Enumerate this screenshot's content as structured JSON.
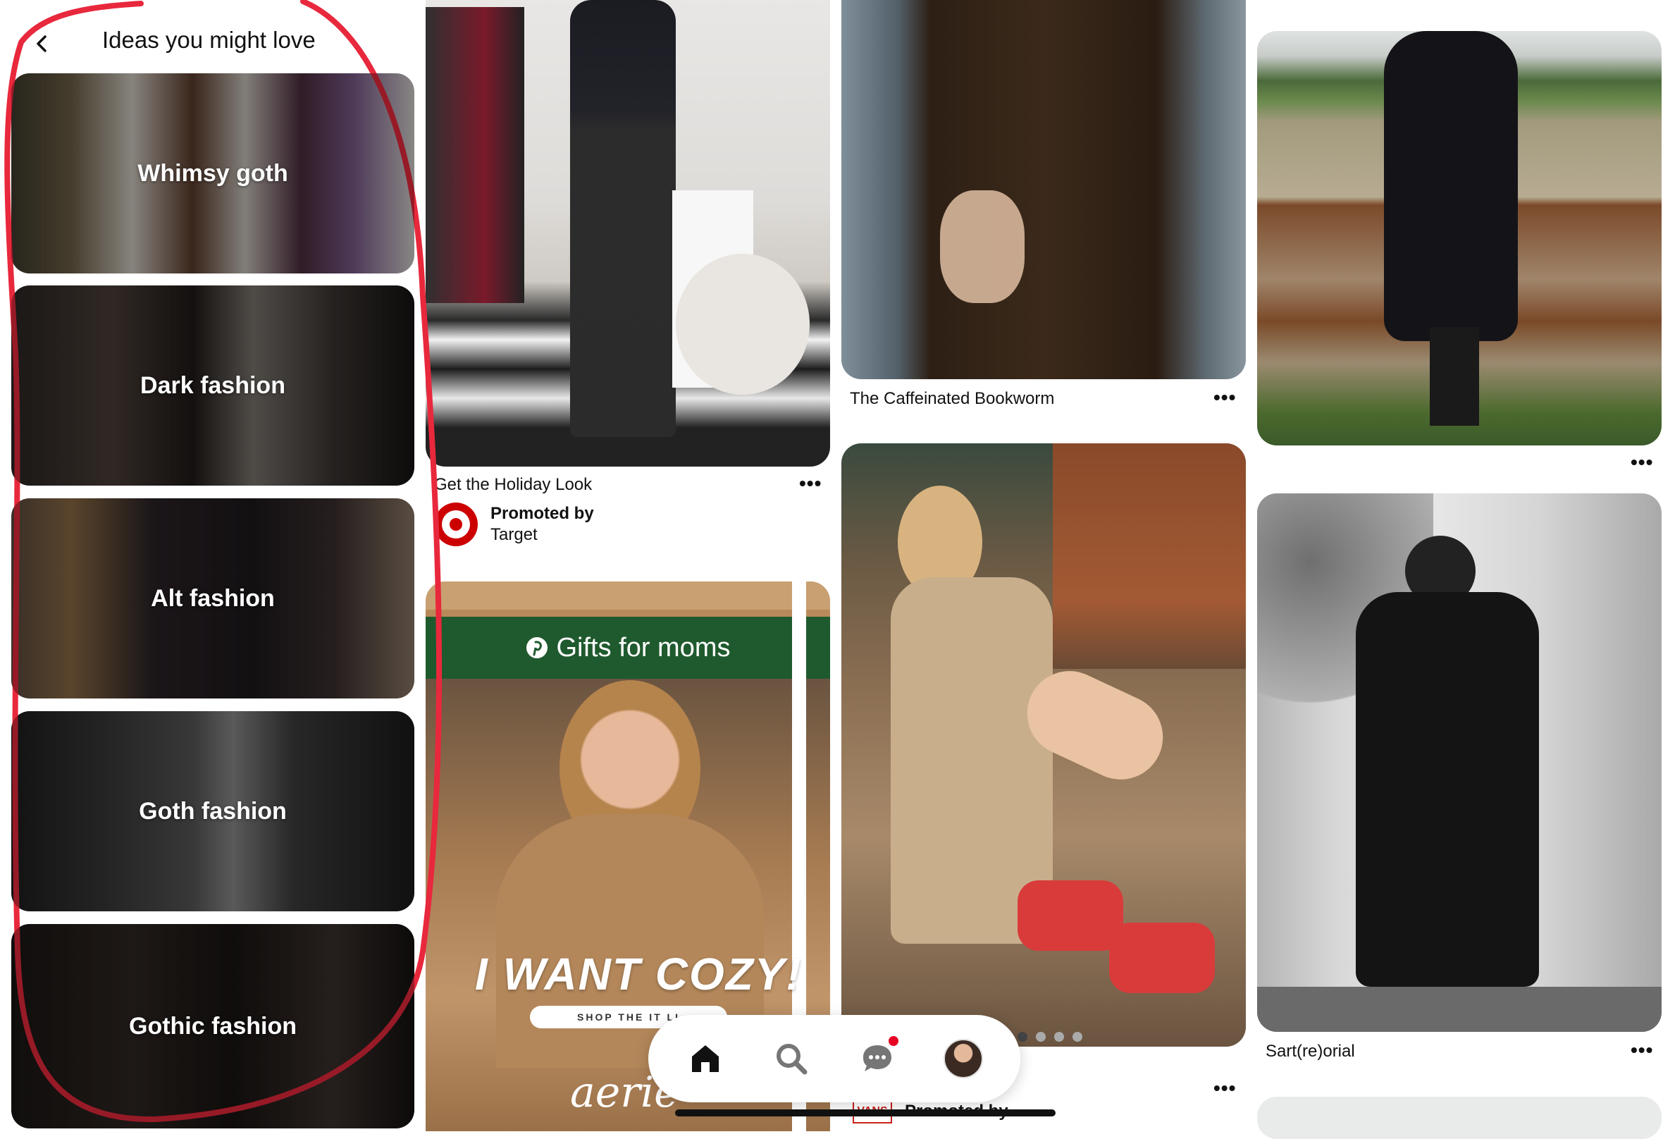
{
  "ideas": {
    "title": "Ideas you might love",
    "cards": [
      {
        "label": "Whimsy goth"
      },
      {
        "label": "Dark fashion"
      },
      {
        "label": "Alt fashion"
      },
      {
        "label": "Goth fashion"
      },
      {
        "label": "Gothic fashion"
      }
    ]
  },
  "feed": {
    "col2": {
      "pin1": {
        "title": "Get the Holiday Look",
        "promoted": "Promoted by",
        "advertiser": "Target"
      },
      "pin2": {
        "headline": "Gifts for moms",
        "tagline": "I WANT COZY!",
        "cta": "SHOP THE IT LI",
        "brand": "aerie"
      }
    },
    "col3": {
      "pin1": {
        "title": "The Caffeinated Bookworm"
      },
      "pin2": {
        "promoted": "Promoted by",
        "brand_logo": "VANS"
      }
    },
    "col4": {
      "pin2": {
        "title": "Sart(re)orial"
      }
    },
    "more_label": "•••"
  },
  "nav": {
    "items": [
      "home-icon",
      "search-icon",
      "messages-icon",
      "profile-avatar"
    ],
    "notification": true
  },
  "colors": {
    "accent": "#e60023",
    "annotation": "#e8283c",
    "target_red": "#cc0000",
    "aerie_green": "#1f5a2e"
  }
}
